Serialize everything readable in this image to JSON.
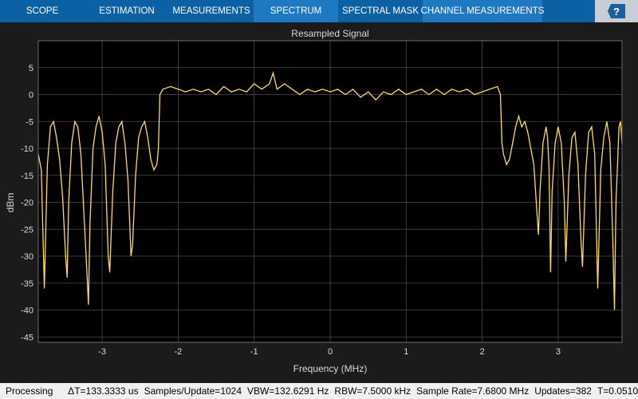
{
  "toolbar": {
    "tabs": [
      {
        "label": "SCOPE"
      },
      {
        "label": "ESTIMATION"
      },
      {
        "label": "MEASUREMENTS"
      },
      {
        "label": "SPECTRUM"
      },
      {
        "label": "SPECTRAL MASK"
      },
      {
        "label": "CHANNEL MEASUREMENTS"
      }
    ],
    "help_label": "?"
  },
  "colors": {
    "toolbar_bg": "#0b61a4",
    "active_tab": "#1e79c0",
    "plot_bg": "#000000",
    "figure_bg": "#1b1b1b",
    "grid": "#4a4a4a",
    "trace": "#ffd966",
    "axis_text": "#d9d9d9"
  },
  "chart_data": {
    "type": "line",
    "title": "Resampled Signal",
    "xlabel": "Frequency (MHz)",
    "ylabel": "dBm",
    "xlim": [
      -3.84,
      3.84
    ],
    "ylim": [
      -46,
      10
    ],
    "grid": true,
    "xticks": [
      -3,
      -2,
      -1,
      0,
      1,
      2,
      3
    ],
    "yticks": [
      5,
      0,
      -5,
      -10,
      -15,
      -20,
      -25,
      -30,
      -35,
      -40,
      -45
    ],
    "series": [
      {
        "points": [
          [
            -3.84,
            -11
          ],
          [
            -3.8,
            -14
          ],
          [
            -3.76,
            -36
          ],
          [
            -3.72,
            -13
          ],
          [
            -3.68,
            -6
          ],
          [
            -3.64,
            -5
          ],
          [
            -3.6,
            -8
          ],
          [
            -3.56,
            -12
          ],
          [
            -3.52,
            -19
          ],
          [
            -3.48,
            -30
          ],
          [
            -3.46,
            -34
          ],
          [
            -3.44,
            -20
          ],
          [
            -3.4,
            -9
          ],
          [
            -3.36,
            -5
          ],
          [
            -3.32,
            -6
          ],
          [
            -3.28,
            -11
          ],
          [
            -3.24,
            -22
          ],
          [
            -3.2,
            -33
          ],
          [
            -3.18,
            -39
          ],
          [
            -3.16,
            -24
          ],
          [
            -3.12,
            -10
          ],
          [
            -3.08,
            -6
          ],
          [
            -3.04,
            -4
          ],
          [
            -3.0,
            -7
          ],
          [
            -2.96,
            -13
          ],
          [
            -2.92,
            -30
          ],
          [
            -2.9,
            -33
          ],
          [
            -2.86,
            -18
          ],
          [
            -2.82,
            -9
          ],
          [
            -2.78,
            -6
          ],
          [
            -2.74,
            -5
          ],
          [
            -2.7,
            -9
          ],
          [
            -2.66,
            -16
          ],
          [
            -2.62,
            -30
          ],
          [
            -2.6,
            -28
          ],
          [
            -2.56,
            -15
          ],
          [
            -2.52,
            -8
          ],
          [
            -2.48,
            -6
          ],
          [
            -2.44,
            -5
          ],
          [
            -2.4,
            -8
          ],
          [
            -2.36,
            -12
          ],
          [
            -2.32,
            -14
          ],
          [
            -2.28,
            -13
          ],
          [
            -2.26,
            -10
          ],
          [
            -2.24,
            0
          ],
          [
            -2.2,
            1
          ],
          [
            -2.1,
            1.5
          ],
          [
            -2.0,
            1
          ],
          [
            -1.9,
            0.5
          ],
          [
            -1.8,
            1
          ],
          [
            -1.7,
            0.5
          ],
          [
            -1.6,
            1
          ],
          [
            -1.5,
            0
          ],
          [
            -1.4,
            1.5
          ],
          [
            -1.3,
            0.5
          ],
          [
            -1.2,
            1
          ],
          [
            -1.1,
            0.5
          ],
          [
            -1.0,
            2
          ],
          [
            -0.9,
            1
          ],
          [
            -0.8,
            2
          ],
          [
            -0.75,
            4
          ],
          [
            -0.7,
            1
          ],
          [
            -0.6,
            2
          ],
          [
            -0.5,
            1
          ],
          [
            -0.4,
            0
          ],
          [
            -0.3,
            1
          ],
          [
            -0.2,
            0.5
          ],
          [
            -0.1,
            1
          ],
          [
            0.0,
            0.5
          ],
          [
            0.1,
            1
          ],
          [
            0.2,
            0
          ],
          [
            0.3,
            1
          ],
          [
            0.4,
            -0.5
          ],
          [
            0.5,
            0.5
          ],
          [
            0.6,
            -1
          ],
          [
            0.7,
            0.5
          ],
          [
            0.8,
            0
          ],
          [
            0.9,
            1
          ],
          [
            1.0,
            0
          ],
          [
            1.1,
            0.5
          ],
          [
            1.2,
            1
          ],
          [
            1.3,
            0
          ],
          [
            1.4,
            1
          ],
          [
            1.5,
            0
          ],
          [
            1.6,
            1
          ],
          [
            1.7,
            0.5
          ],
          [
            1.8,
            1
          ],
          [
            1.9,
            0
          ],
          [
            2.0,
            0.5
          ],
          [
            2.1,
            1
          ],
          [
            2.2,
            1.5
          ],
          [
            2.24,
            0
          ],
          [
            2.26,
            -9
          ],
          [
            2.28,
            -11
          ],
          [
            2.32,
            -13
          ],
          [
            2.36,
            -12
          ],
          [
            2.4,
            -9
          ],
          [
            2.44,
            -6
          ],
          [
            2.48,
            -4
          ],
          [
            2.52,
            -6
          ],
          [
            2.56,
            -5
          ],
          [
            2.6,
            -7
          ],
          [
            2.64,
            -10
          ],
          [
            2.68,
            -13
          ],
          [
            2.72,
            -22
          ],
          [
            2.74,
            -26
          ],
          [
            2.76,
            -18
          ],
          [
            2.8,
            -9
          ],
          [
            2.84,
            -6
          ],
          [
            2.86,
            -8
          ],
          [
            2.88,
            -14
          ],
          [
            2.9,
            -33
          ],
          [
            2.92,
            -18
          ],
          [
            2.96,
            -9
          ],
          [
            3.0,
            -6
          ],
          [
            3.04,
            -9
          ],
          [
            3.08,
            -20
          ],
          [
            3.1,
            -31
          ],
          [
            3.14,
            -15
          ],
          [
            3.18,
            -8
          ],
          [
            3.22,
            -7
          ],
          [
            3.26,
            -13
          ],
          [
            3.3,
            -27
          ],
          [
            3.32,
            -32
          ],
          [
            3.36,
            -15
          ],
          [
            3.4,
            -7
          ],
          [
            3.44,
            -6
          ],
          [
            3.48,
            -11
          ],
          [
            3.52,
            -36
          ],
          [
            3.56,
            -14
          ],
          [
            3.6,
            -8
          ],
          [
            3.64,
            -5
          ],
          [
            3.68,
            -9
          ],
          [
            3.72,
            -28
          ],
          [
            3.74,
            -40
          ],
          [
            3.76,
            -20
          ],
          [
            3.8,
            -6
          ],
          [
            3.82,
            -5
          ],
          [
            3.84,
            -9
          ]
        ]
      }
    ]
  },
  "status": {
    "state": "Processing",
    "delta_t": "ΔT=133.3333 us",
    "samples_per_update": "Samples/Update=1024",
    "vbw": "VBW=132.6291 Hz",
    "rbw": "RBW=7.5000 kHz",
    "sample_rate": "Sample Rate=7.6800 MHz",
    "updates": "Updates=382",
    "t": "T=0.0510"
  }
}
